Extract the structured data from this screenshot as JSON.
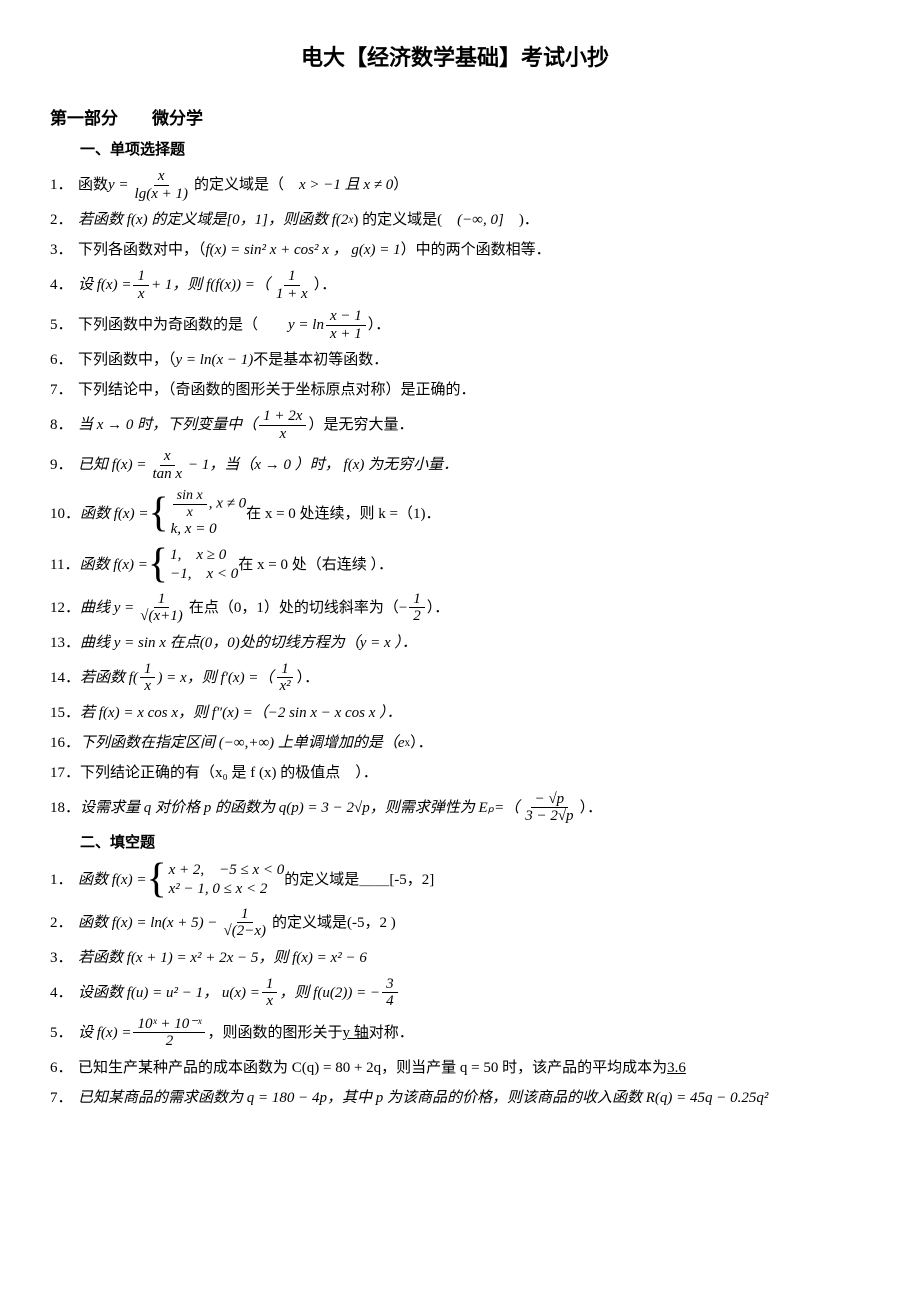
{
  "title": "电大【经济数学基础】考试小抄",
  "part1_head": "第一部分　　微分学",
  "mc_head": "一、单项选择题",
  "mc": {
    "n1": "1．",
    "q1a": "函数 ",
    "q1_y": "y = ",
    "q1_top": "x",
    "q1_bot": "lg(x + 1)",
    "q1b": " 的定义域是（　",
    "q1_ans": "x > −1  且 x ≠ 0",
    "q1c": "）",
    "n2": "2．",
    "q2a": "若函数 f(x) 的定义域是[0，1]，则函数 f(2",
    "q2_sup": "x",
    "q2b": ") 的定义域是(　",
    "q2_ans": "(−∞, 0]",
    "q2c": "　)．",
    "n3": "3．",
    "q3a": "下列各函数对中，（ ",
    "q3_f": "f(x) = sin² x + cos² x ， g(x) = 1",
    "q3b": "）中的两个函数相等．",
    "n4": "4．",
    "q4a": "设 f(x) = ",
    "q4_top1": "1",
    "q4_bot1": "x",
    "q4b": " + 1，则 f(f(x)) =（ ",
    "q4_top2": "1",
    "q4_bot2": "1 + x",
    "q4c": " ）．",
    "n5": "5．",
    "q5a": "下列函数中为奇函数的是（　　",
    "q5_y": "y = ln",
    "q5_top": "x − 1",
    "q5_bot": "x + 1",
    "q5b": " ）．",
    "n6": "6．",
    "q6a": "下列函数中，（",
    "q6_f": "y = ln(x − 1)",
    "q6b": " 不是基本初等函数．",
    "n7": "7．",
    "q7": "下列结论中，（奇函数的图形关于坐标原点对称）是正确的．",
    "n8": "8．",
    "q8a": "当 x → 0 时，下列变量中（",
    "q8_top": "1 + 2x",
    "q8_bot": "x",
    "q8b": " ）是无穷大量．",
    "n9": "9．",
    "q9a": "已知 f(x) = ",
    "q9_top": "x",
    "q9_bot": "tan x",
    "q9b": " − 1，当（x → 0 ）时， f(x) 为无穷小量．",
    "n10": "10．",
    "q10a": "函数 f(x) = ",
    "q10_l1a": "sin x",
    "q10_l1b": "x",
    "q10_l1c": ",  x ≠ 0",
    "q10_l2": "k,  x = 0",
    "q10b": "  在 x = 0 处连续，则 k =（1)．",
    "n11": "11．",
    "q11a": "函数 f(x) = ",
    "q11_l1": "1,　x ≥ 0",
    "q11_l2": "−1,　x < 0",
    "q11b": "  在 x = 0 处（右连续 ）．",
    "n12": "12．",
    "q12a": "曲线 y = ",
    "q12_top": "1",
    "q12_bot": "√(x+1)",
    "q12b": " 在点（0，1）处的切线斜率为（−",
    "q12_top2": "1",
    "q12_bot2": "2",
    "q12c": " ）．",
    "n13": "13．",
    "q13": "曲线 y = sin x 在点(0，0)处的切线方程为（y = x ）．",
    "n14": "14．",
    "q14a": "若函数 f(",
    "q14_top1": "1",
    "q14_bot1": "x",
    "q14b": ") = x，则 f′(x) =（",
    "q14_top2": "1",
    "q14_bot2": "x²",
    "q14c": " ）．",
    "n15": "15．",
    "q15": "若 f(x) = x cos x，则 f″(x) =（−2 sin x − x cos x ）．",
    "n16": "16．",
    "q16a": "下列函数在指定区间 (−∞,+∞) 上单调增加的是（e",
    "q16_sup": " x",
    "q16b": "）．",
    "n17": "17．",
    "q17": "下列结论正确的有（x₀ 是 f (x) 的极值点　）．",
    "n18": "18．",
    "q18a": "设需求量 q 对价格 p 的函数为 q(p) = 3 − 2√p，则需求弹性为 Eₚ=（",
    "q18_top": "− √p",
    "q18_bot": "3 − 2√p",
    "q18b": " ）．"
  },
  "fb_head": "二、填空题",
  "fb": {
    "n1": "1．",
    "q1a": "函数 f(x) = ",
    "q1_l1": "x + 2,　−5 ≤ x < 0",
    "q1_l2": "x² − 1,  0 ≤ x < 2",
    "q1b": " 的定义域是＿＿",
    "q1_ans": "[-5，2]",
    "n2": "2．",
    "q2a": "函数 f(x) = ln(x + 5) − ",
    "q2_top": "1",
    "q2_bot": "√(2−x)",
    "q2b": " 的定义域是",
    "q2_ans": "(-5，2 )",
    "n3": "3．",
    "q3": "若函数 f(x + 1) = x² + 2x − 5，则 f(x) = x² − 6",
    "n4": "4．",
    "q4a": "设函数 f(u) = u² − 1， u(x) = ",
    "q4_top1": "1",
    "q4_bot1": "x",
    "q4b": "，则 f(u(2)) = −",
    "q4_top2": "3",
    "q4_bot2": "4",
    "n5": "5．",
    "q5a": "设 f(x) = ",
    "q5_top": "10ˣ + 10⁻ˣ",
    "q5_bot": "2",
    "q5b": "，则函数的图形关于",
    "q5_ans": " y 轴",
    "q5c": "对称．",
    "n6": "6．",
    "q6a": "已知生产某种产品的成本函数为 C(q) = 80 + 2q，则当产量 q = 50 时，该产品的平均成本为 ",
    "q6_ans": "3.6",
    "n7": "7．",
    "q7": "已知某商品的需求函数为 q = 180 − 4p，其中 p 为该商品的价格，则该商品的收入函数 R(q) = 45q − 0.25q²"
  }
}
